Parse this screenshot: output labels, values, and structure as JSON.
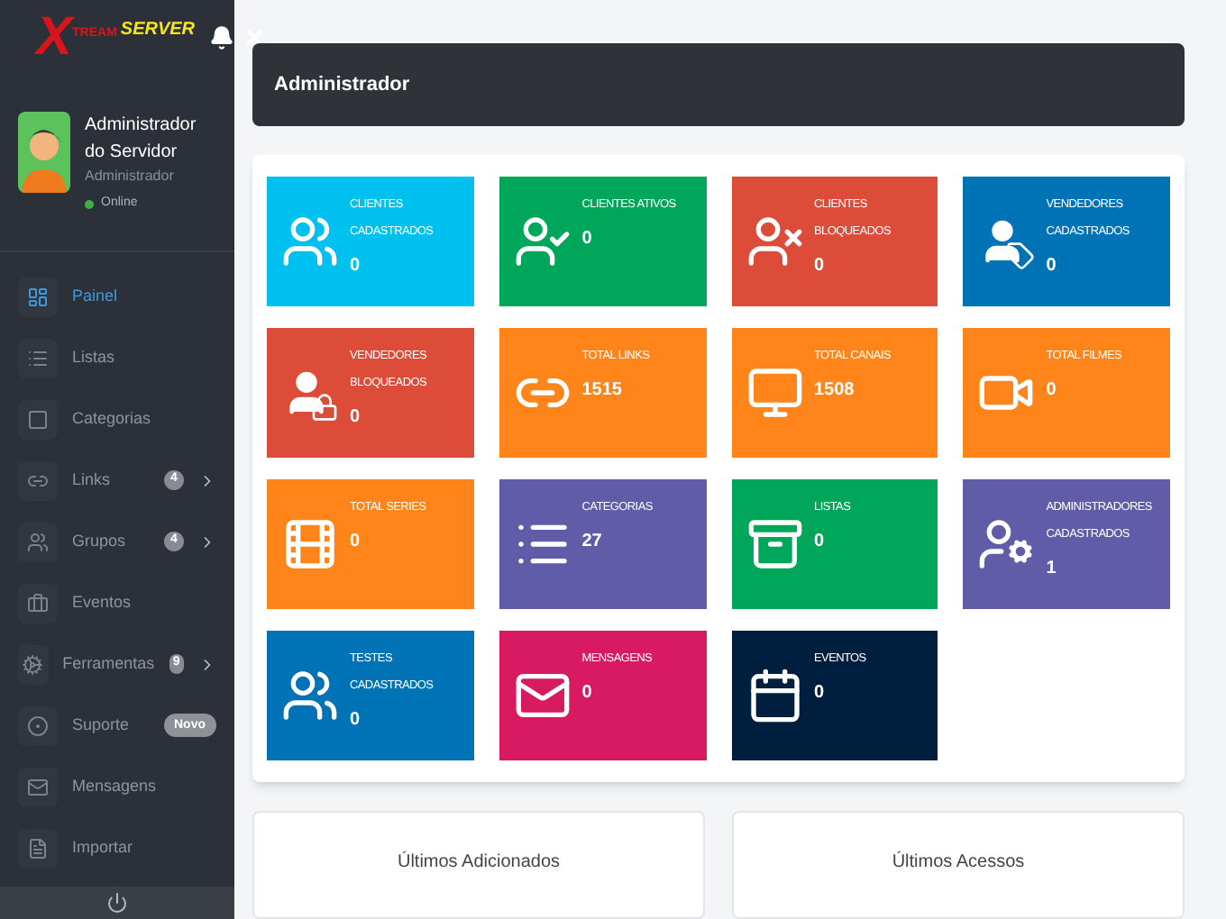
{
  "logo": {
    "initial": "X",
    "word_1": "TREAM",
    "word_2": "SERVER"
  },
  "profile": {
    "name": "Administrador do Servidor",
    "role": "Administrador",
    "status": "Online",
    "online": true
  },
  "menu": [
    {
      "label": "Painel",
      "selected": true,
      "submenu": false
    },
    {
      "label": "Listas",
      "selected": false,
      "submenu": false
    },
    {
      "label": "Categorias",
      "selected": false,
      "submenu": false
    },
    {
      "label": "Links",
      "selected": false,
      "badge": "4",
      "submenu": true
    },
    {
      "label": "Grupos",
      "selected": false,
      "badge": "4",
      "submenu": true
    },
    {
      "label": "Eventos",
      "selected": false,
      "submenu": false
    },
    {
      "label": "Ferramentas",
      "selected": false,
      "badge": "9",
      "submenu": true
    },
    {
      "label": "Suporte",
      "selected": false,
      "tag": "Novo",
      "submenu": false
    },
    {
      "label": "Mensagens",
      "selected": false,
      "submenu": false
    },
    {
      "label": "Importar",
      "selected": false,
      "submenu": false
    }
  ],
  "header": {
    "title": "Administrador"
  },
  "tiles": [
    {
      "title": "CLIENTES CADASTRADOS",
      "value": "0",
      "color": "#00c0ef"
    },
    {
      "title": "CLIENTES ATIVOS",
      "value": "0",
      "color": "#00a65a"
    },
    {
      "title": "CLIENTES BLOQUEADOS",
      "value": "0",
      "color": "#dd4b39"
    },
    {
      "title": "VENDEDORES CADASTRADOS",
      "value": "0",
      "color": "#0073b7"
    },
    {
      "title": "VENDEDORES BLOQUEADOS",
      "value": "0",
      "color": "#dd4b39"
    },
    {
      "title": "TOTAL LINKS",
      "value": "1515",
      "color": "#ff851b"
    },
    {
      "title": "TOTAL CANAIS",
      "value": "1508",
      "color": "#ff851b"
    },
    {
      "title": "TOTAL FILMES",
      "value": "0",
      "color": "#ff851b"
    },
    {
      "title": "TOTAL SERIES",
      "value": "0",
      "color": "#ff851b"
    },
    {
      "title": "CATEGORIAS",
      "value": "27",
      "color": "#605ca8"
    },
    {
      "title": "LISTAS",
      "value": "0",
      "color": "#00a65a"
    },
    {
      "title": "ADMINISTRADORES CADASTRADOS",
      "value": "1",
      "color": "#605ca8"
    },
    {
      "title": "TESTES CADASTRADOS",
      "value": "0",
      "color": "#0073b7"
    },
    {
      "title": "MENSAGENS",
      "value": "0",
      "color": "#d81b60"
    },
    {
      "title": "EVENTOS",
      "value": "0",
      "color": "#001f3f"
    }
  ],
  "panels": [
    {
      "title": "Últimos Adicionados"
    },
    {
      "title": "Últimos Acessos"
    }
  ]
}
